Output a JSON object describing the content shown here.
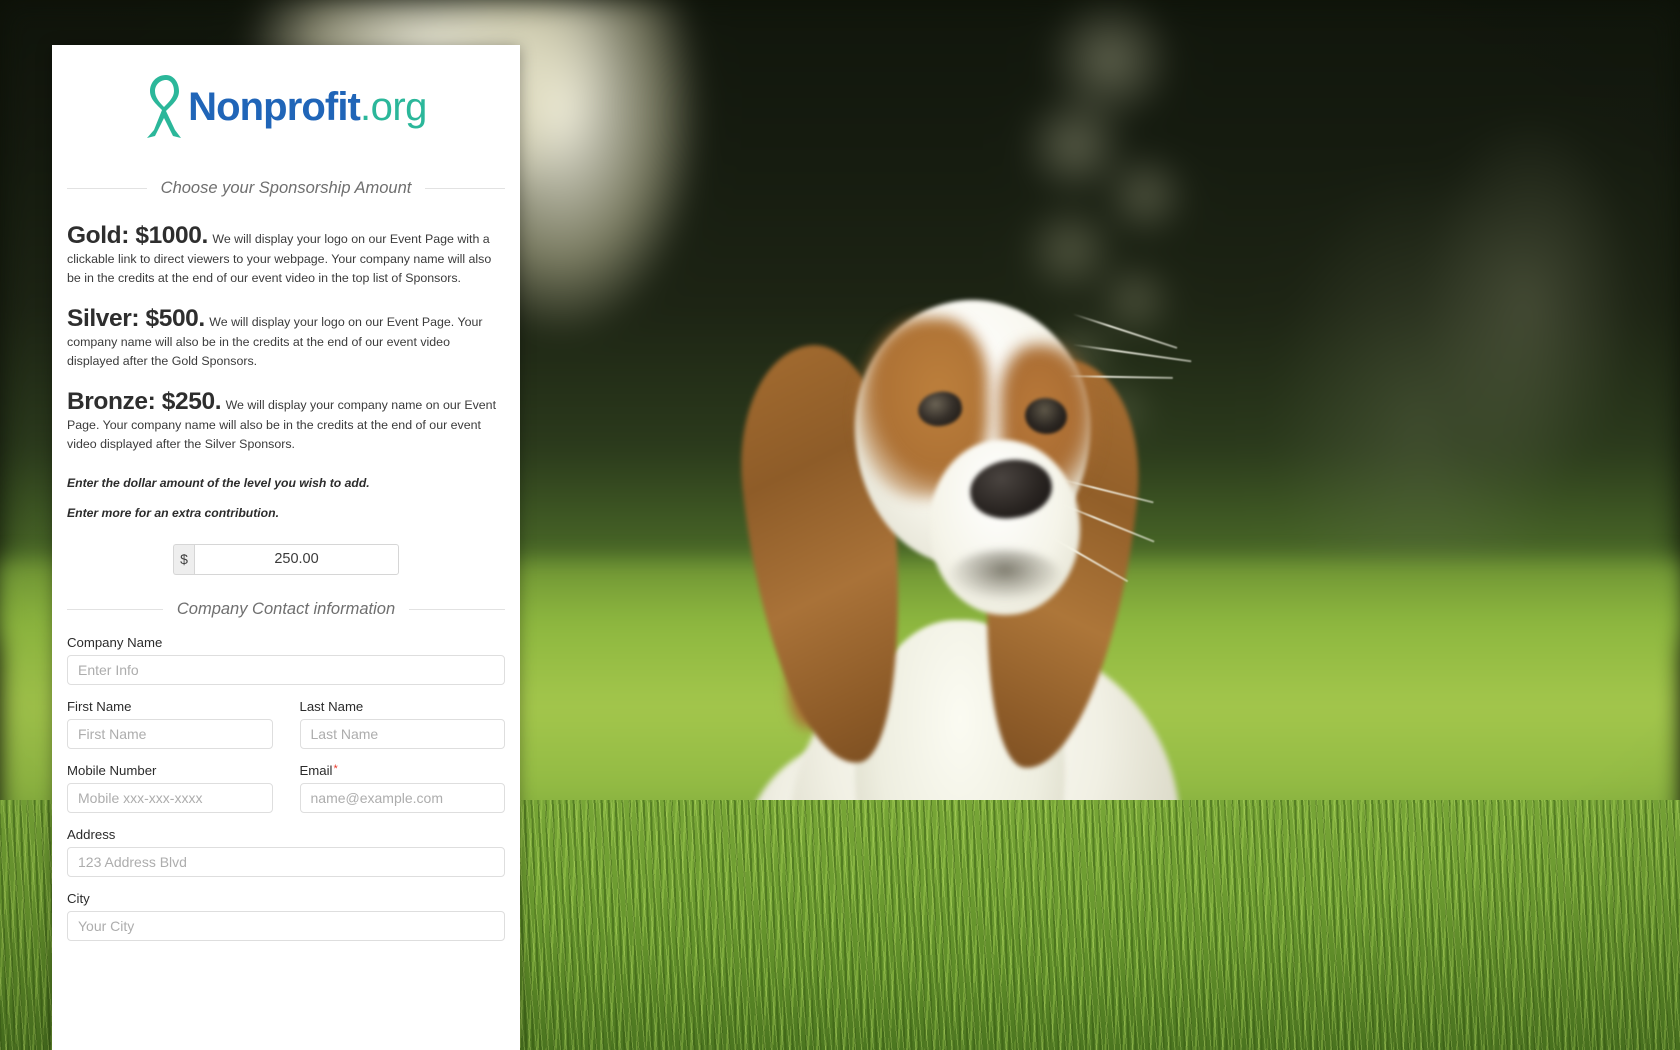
{
  "brand": {
    "icon": "ribbon-icon",
    "name_main": "Nonprofit",
    "name_tld": ".org",
    "color_main": "#2065b8",
    "color_tld": "#2bb79a",
    "ribbon_color": "#2bb79a"
  },
  "sections": {
    "sponsorship_heading": "Choose your Sponsorship Amount",
    "contact_heading": "Company Contact information"
  },
  "tiers": [
    {
      "name": "Gold: $1000.",
      "description": "We will display your logo on our Event Page with a clickable link to direct viewers to your webpage. Your company name will also be in the credits at the end of our event video in the top list of Sponsors."
    },
    {
      "name": "Silver: $500.",
      "description": "We will display your logo on our Event Page. Your company name will also be in the credits at the end of our event video displayed after the Gold Sponsors."
    },
    {
      "name": "Bronze: $250.",
      "description": "We will display your company name on our Event Page. Your company name will also be in the credits at the end of our event video displayed after the Silver Sponsors."
    }
  ],
  "notes": {
    "line1": "Enter the dollar amount of the level you wish to add.",
    "line2": "Enter more for an extra contribution."
  },
  "amount": {
    "currency_symbol": "$",
    "value": "250.00"
  },
  "fields": {
    "company_name": {
      "label": "Company Name",
      "placeholder": "Enter Info",
      "value": ""
    },
    "first_name": {
      "label": "First Name",
      "placeholder": "First Name",
      "value": ""
    },
    "last_name": {
      "label": "Last Name",
      "placeholder": "Last Name",
      "value": ""
    },
    "mobile": {
      "label": "Mobile Number",
      "placeholder": "Mobile xxx-xxx-xxxx",
      "value": ""
    },
    "email": {
      "label": "Email",
      "required_marker": "*",
      "placeholder": "name@example.com",
      "value": ""
    },
    "address": {
      "label": "Address",
      "placeholder": "123 Address Blvd",
      "value": ""
    },
    "city": {
      "label": "City",
      "placeholder": "Your City",
      "value": ""
    }
  },
  "background": {
    "description": "basset-hound-puppy-in-grass-photo"
  }
}
